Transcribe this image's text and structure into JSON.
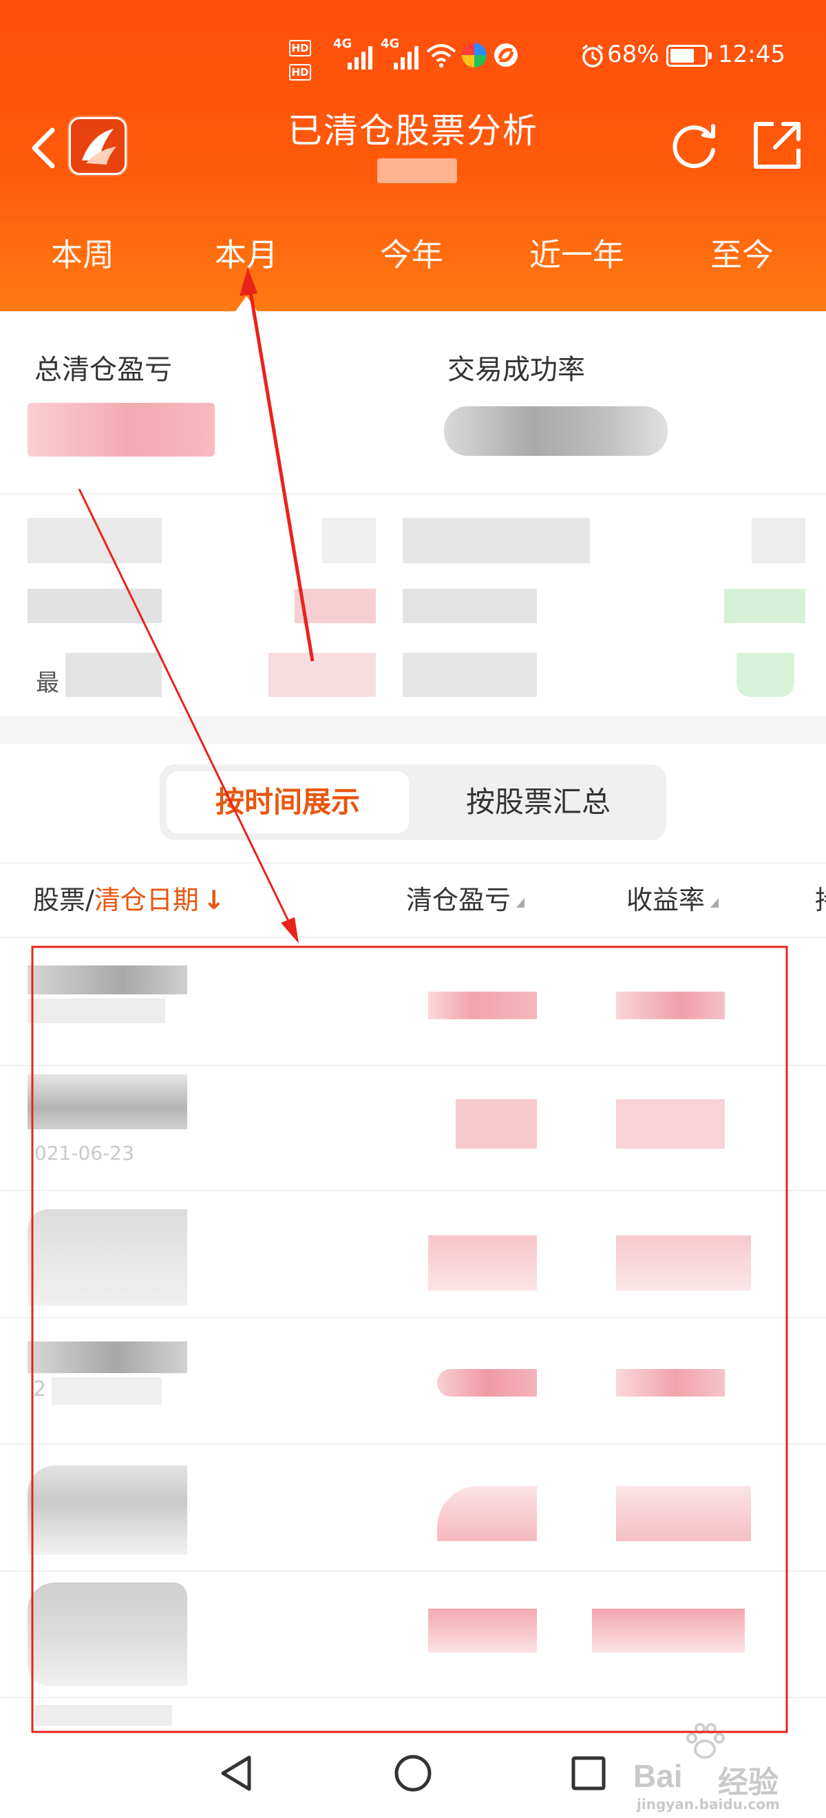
{
  "status_bar": {
    "hd1": "HD",
    "hd2": "HD",
    "net1": "4G",
    "net2": "4G",
    "battery_percent": "68%",
    "time": "12:45"
  },
  "header": {
    "title": "已清仓股票分析",
    "period_tabs": [
      "本周",
      "本月",
      "今年",
      "近一年",
      "至今"
    ],
    "active_tab_index": 1
  },
  "summary": {
    "total_pnl_label": "总清仓盈亏",
    "success_rate_label": "交易成功率",
    "row_label_1": "最"
  },
  "view_toggle": {
    "by_time": "按时间展示",
    "by_stock": "按股票汇总",
    "active": "by_time"
  },
  "list_header": {
    "stock": "股票/",
    "sort_field": "清仓日期",
    "sort_arrow": "↓",
    "pnl": "清仓盈亏",
    "return_rate": "收益率",
    "extra": "持"
  },
  "list_rows": {
    "row2_date": "021-06-23",
    "row4_date": "2"
  },
  "watermark": {
    "brand": "Bai",
    "brand_cn": "经验",
    "url": "jingyan.baidu.com"
  },
  "colors": {
    "header_orange": "#ff5a0a",
    "accent": "#e8560f",
    "annotation_red": "#e8231a"
  }
}
